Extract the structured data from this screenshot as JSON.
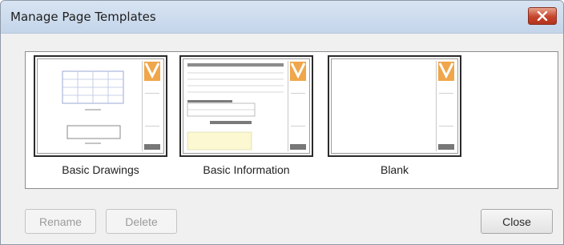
{
  "window": {
    "title": "Manage Page Templates",
    "close_icon": "close-x-icon",
    "accent": "#c6442c"
  },
  "templates": [
    {
      "label": "Basic Drawings"
    },
    {
      "label": "Basic Information"
    },
    {
      "label": "Blank"
    }
  ],
  "buttons": {
    "rename": "Rename",
    "delete": "Delete",
    "close": "Close"
  },
  "logo_color": "#f0a64a"
}
